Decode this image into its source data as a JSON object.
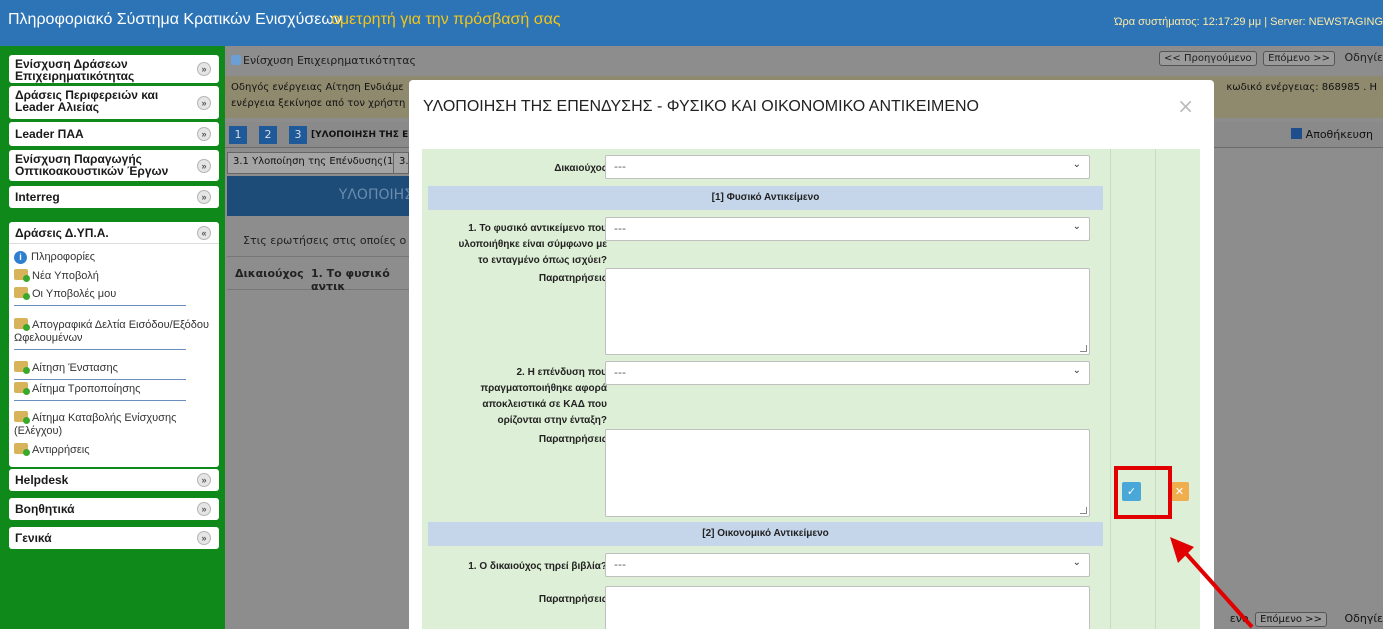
{
  "header": {
    "title": "Πληροφοριακό Σύστημα Κρατικών Ενισχύσεων",
    "marquee": "ομετρητή για την πρόσβασή σας",
    "sysinfo": "Ώρα συστήματος: 12:17:29 μμ | Server: NEWSTAGING"
  },
  "sidebar": {
    "groups": [
      {
        "label": "Ενίσχυση Δράσεων Επιχειρηματικότητας"
      },
      {
        "label": "Δράσεις Περιφερειών και Leader Αλιείας"
      },
      {
        "label": "Leader ΠΑΑ"
      },
      {
        "label": "Ενίσχυση Παραγωγής Οπτικοακουστικών Έργων"
      },
      {
        "label": "Interreg"
      },
      {
        "label": "Δράσεις Δ.ΥΠ.Α."
      },
      {
        "label": "Helpdesk"
      },
      {
        "label": "Βοηθητικά"
      },
      {
        "label": "Γενικά"
      }
    ],
    "items": [
      {
        "label": "Πληροφορίες"
      },
      {
        "label": "Νέα Υποβολή"
      },
      {
        "label": "Οι Υποβολές μου"
      },
      {
        "label": "Απογραφικά Δελτία Εισόδου/Εξόδου Ωφελουμένων"
      },
      {
        "label": "Αίτηση Ένστασης"
      },
      {
        "label": "Αίτημα Τροποποίησης"
      },
      {
        "label": "Αίτημα Καταβολής Ενίσχυσης (Ελέγχου)"
      },
      {
        "label": "Αντιρρήσεις"
      }
    ]
  },
  "main": {
    "title": "Ενίσχυση Επιχειρηματικότητας",
    "prev_label": "<< Προηγούμενο",
    "next_label": "Επόμενο >>",
    "help_label": "Οδηγίε",
    "notice_line1": "Οδηγός ενέργειας Αίτηση Ενδιάμε",
    "notice_line2": "ενέργεια ξεκίνησε από τον χρήστη",
    "notice_right": "κωδικό ενέργειας: 868985 . Η",
    "steps": [
      "1",
      "2",
      "3"
    ],
    "step_title": "[ΥΛΟΠΟΙΗΣΗ ΤΗΣ Ε",
    "save_label": "Αποθήκευση",
    "tab1": "3.1 Υλοποίηση της Επένδυσης(1)",
    "tab2": "3.",
    "blue_banner": "ΥΛΟΠΟΙΗΣ",
    "question_text": "Στις ερωτήσεις στις οποίες ο δικ",
    "col_head1": "Δικαιούχος",
    "col_head2": "1. Το φυσικό αντικ",
    "bottom_prev": "ενο",
    "bottom_next": "Επόμενο >>",
    "bottom_help": "Οδηγίε"
  },
  "modal": {
    "title": "ΥΛΟΠΟΙΗΣΗ ΤΗΣ ΕΠΕΝΔΥΣΗΣ - ΦΥΣΙΚΟ ΚΑΙ ΟΙΚΟΝΟΜΙΚΟ ΑΝΤΙΚΕΙΜΕΝΟ",
    "close": "×",
    "beneficiary_label": "Δικαιούχος",
    "select_value": "---",
    "section1": "[1] Φυσικό Αντικείμενο",
    "q1_label": "1. Το φυσικό αντικείμενο που υλοποιήθηκε είναι σύμφωνο με το ενταγμένο όπως ισχύει?",
    "remarks_label": "Παρατηρήσεις",
    "q2_label": "2. Η επένδυση που πραγματοποιήθηκε αφορά αποκλειστικά σε ΚΑΔ που ορίζονται στην ένταξη?",
    "section2": "[2] Οικονομικό Αντικείμενο",
    "q3_label": "1. Ο δικαιούχος τηρεί βιβλία?"
  },
  "colors": {
    "header_bg": "#2c74b5",
    "sidebar_bg": "#0f8a1a",
    "highlight": "#e00000",
    "save_btn": "#4aa8d8",
    "cancel_btn": "#f0ad4e"
  }
}
